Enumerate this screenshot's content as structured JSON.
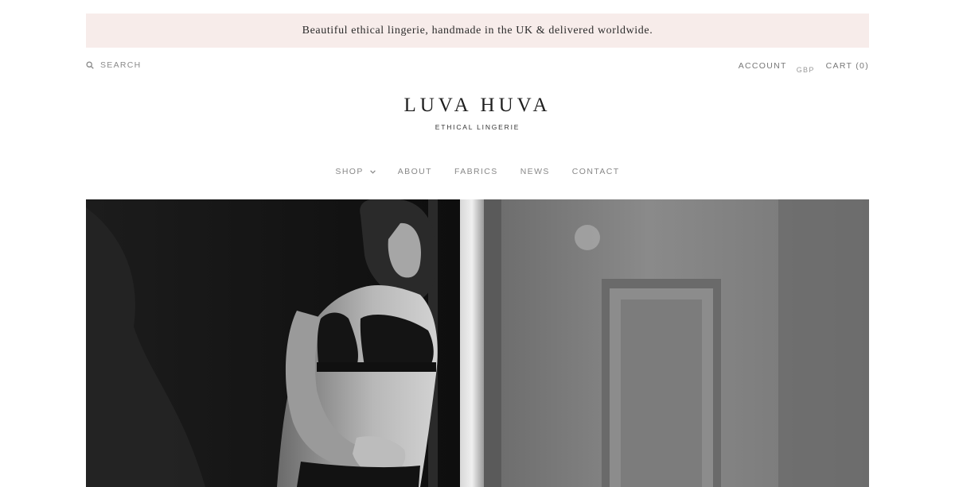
{
  "announcement": {
    "text": "Beautiful ethical lingerie, handmade in the UK & delivered worldwide."
  },
  "header": {
    "search_label": "SEARCH",
    "account_label": "ACCOUNT",
    "currency_label": "GBP",
    "cart_label": "CART (0)"
  },
  "logo": {
    "name": "LUVA HUVA",
    "tagline": "ETHICAL LINGERIE"
  },
  "nav": {
    "items": [
      {
        "label": "SHOP"
      },
      {
        "label": "ABOUT"
      },
      {
        "label": "FABRICS"
      },
      {
        "label": "NEWS"
      },
      {
        "label": "CONTACT"
      }
    ]
  },
  "icons": {
    "search": "search-icon",
    "shop_dropdown": "chevron-down-icon"
  },
  "colors": {
    "announcement_bg": "#f7ecea",
    "text_dark": "#1f1f1f",
    "nav_text": "#888888"
  }
}
